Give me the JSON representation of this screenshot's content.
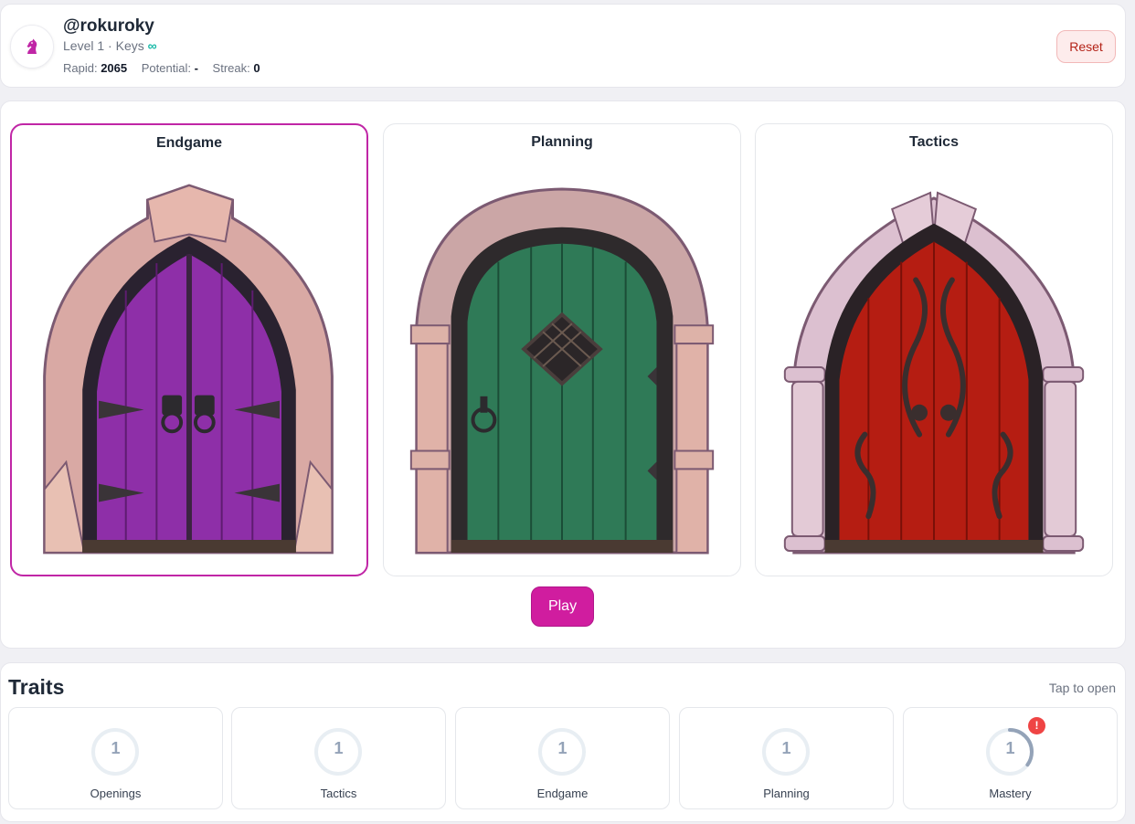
{
  "profile": {
    "username": "@rokuroky",
    "level": "Level 1",
    "keys_label": "Keys",
    "keys_value": "∞",
    "rapid_label": "Rapid:",
    "rapid_value": "2065",
    "potential_label": "Potential:",
    "potential_value": "-",
    "streak_label": "Streak:",
    "streak_value": "0",
    "avatar_icon": "knight-icon",
    "reset_label": "Reset"
  },
  "doors": [
    {
      "title": "Endgame",
      "selected": true,
      "color": "#8e2fa8"
    },
    {
      "title": "Planning",
      "selected": false,
      "color": "#2f7a57"
    },
    {
      "title": "Tactics",
      "selected": false,
      "color": "#b51d12"
    }
  ],
  "play_label": "Play",
  "traits": {
    "title": "Traits",
    "hint": "Tap to open",
    "items": [
      {
        "label": "Openings",
        "value": "1",
        "progress": 0
      },
      {
        "label": "Tactics",
        "value": "1",
        "progress": 0
      },
      {
        "label": "Endgame",
        "value": "1",
        "progress": 0
      },
      {
        "label": "Planning",
        "value": "1",
        "progress": 0
      },
      {
        "label": "Mastery",
        "value": "1",
        "progress": 0.35,
        "alert": "!"
      }
    ]
  },
  "colors": {
    "accent": "#d01d9f",
    "reset_bg": "#fdecec",
    "reset_text": "#b42318",
    "ring_track": "#e8eef3",
    "ring_progress": "#94a3b8",
    "alert": "#ef4444"
  }
}
